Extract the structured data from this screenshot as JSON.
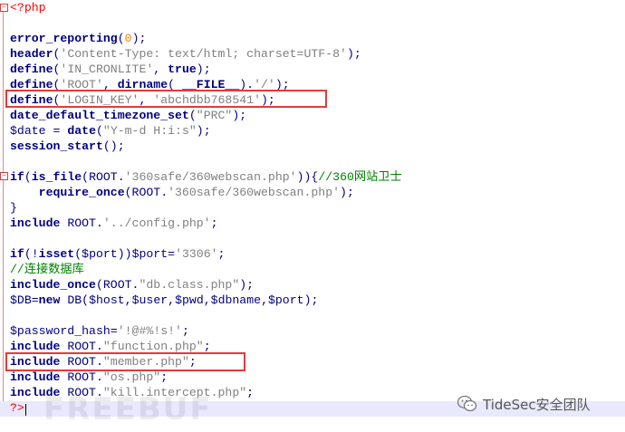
{
  "editor": {
    "lines": [
      {
        "segments": [
          {
            "t": "<?php",
            "c": "php"
          }
        ]
      },
      {
        "segments": []
      },
      {
        "segments": [
          {
            "t": "error_reporting",
            "c": "kw"
          },
          {
            "t": "(",
            "c": "op"
          },
          {
            "t": "0",
            "c": "num"
          },
          {
            "t": ");",
            "c": "op"
          }
        ]
      },
      {
        "segments": [
          {
            "t": "header",
            "c": "kw"
          },
          {
            "t": "(",
            "c": "op"
          },
          {
            "t": "'Content-Type: text/html; charset=UTF-8'",
            "c": "str"
          },
          {
            "t": ");",
            "c": "op"
          }
        ]
      },
      {
        "segments": [
          {
            "t": "define",
            "c": "kw"
          },
          {
            "t": "(",
            "c": "op"
          },
          {
            "t": "'IN_CRONLITE'",
            "c": "str"
          },
          {
            "t": ", ",
            "c": "op"
          },
          {
            "t": "true",
            "c": "kw"
          },
          {
            "t": ");",
            "c": "op"
          }
        ]
      },
      {
        "segments": [
          {
            "t": "define",
            "c": "kw"
          },
          {
            "t": "(",
            "c": "op"
          },
          {
            "t": "'ROOT'",
            "c": "str"
          },
          {
            "t": ", ",
            "c": "op"
          },
          {
            "t": "dirname",
            "c": "kw"
          },
          {
            "t": "( ",
            "c": "op"
          },
          {
            "t": "__FILE__",
            "c": "kw"
          },
          {
            "t": ").",
            "c": "op"
          },
          {
            "t": "'/'",
            "c": "str"
          },
          {
            "t": ");",
            "c": "op"
          }
        ]
      },
      {
        "segments": [
          {
            "t": "define",
            "c": "kw"
          },
          {
            "t": "(",
            "c": "op"
          },
          {
            "t": "'LOGIN_KEY'",
            "c": "str"
          },
          {
            "t": ", ",
            "c": "op"
          },
          {
            "t": "'abchdbb768541'",
            "c": "str"
          },
          {
            "t": ");",
            "c": "op"
          }
        ]
      },
      {
        "segments": [
          {
            "t": "date_default_timezone_set",
            "c": "kw"
          },
          {
            "t": "(",
            "c": "op"
          },
          {
            "t": "\"PRC\"",
            "c": "str"
          },
          {
            "t": ");",
            "c": "op"
          }
        ]
      },
      {
        "segments": [
          {
            "t": "$date",
            "c": "var"
          },
          {
            "t": " = ",
            "c": "op"
          },
          {
            "t": "date",
            "c": "kw"
          },
          {
            "t": "(",
            "c": "op"
          },
          {
            "t": "\"Y-m-d H:i:s\"",
            "c": "str"
          },
          {
            "t": ");",
            "c": "op"
          }
        ]
      },
      {
        "segments": [
          {
            "t": "session_start",
            "c": "kw"
          },
          {
            "t": "();",
            "c": "op"
          }
        ]
      },
      {
        "segments": []
      },
      {
        "segments": [
          {
            "t": "if",
            "c": "kw"
          },
          {
            "t": "(",
            "c": "op"
          },
          {
            "t": "is_file",
            "c": "kw"
          },
          {
            "t": "(ROOT.",
            "c": "op"
          },
          {
            "t": "'360safe/360webscan.php'",
            "c": "str"
          },
          {
            "t": ")){",
            "c": "op"
          },
          {
            "t": "//360网站卫士",
            "c": "cm"
          }
        ]
      },
      {
        "segments": [
          {
            "t": "    require_once",
            "c": "kw"
          },
          {
            "t": "(ROOT.",
            "c": "op"
          },
          {
            "t": "'360safe/360webscan.php'",
            "c": "str"
          },
          {
            "t": ");",
            "c": "op"
          }
        ]
      },
      {
        "segments": [
          {
            "t": "}",
            "c": "op"
          }
        ]
      },
      {
        "segments": [
          {
            "t": "include",
            "c": "kw"
          },
          {
            "t": " ROOT.",
            "c": "op"
          },
          {
            "t": "'../config.php'",
            "c": "str"
          },
          {
            "t": ";",
            "c": "op"
          }
        ]
      },
      {
        "segments": []
      },
      {
        "segments": [
          {
            "t": "if",
            "c": "kw"
          },
          {
            "t": "(!",
            "c": "op"
          },
          {
            "t": "isset",
            "c": "kw"
          },
          {
            "t": "(",
            "c": "op"
          },
          {
            "t": "$port",
            "c": "var"
          },
          {
            "t": "))",
            "c": "op"
          },
          {
            "t": "$port",
            "c": "var"
          },
          {
            "t": "=",
            "c": "op"
          },
          {
            "t": "'3306'",
            "c": "str"
          },
          {
            "t": ";",
            "c": "op"
          }
        ]
      },
      {
        "segments": [
          {
            "t": "//连接数据库",
            "c": "cm"
          }
        ]
      },
      {
        "segments": [
          {
            "t": "include_once",
            "c": "kw"
          },
          {
            "t": "(ROOT.",
            "c": "op"
          },
          {
            "t": "\"db.class.php\"",
            "c": "str"
          },
          {
            "t": ");",
            "c": "op"
          }
        ]
      },
      {
        "segments": [
          {
            "t": "$DB",
            "c": "var"
          },
          {
            "t": "=",
            "c": "op"
          },
          {
            "t": "new",
            "c": "kw"
          },
          {
            "t": " DB(",
            "c": "op"
          },
          {
            "t": "$host",
            "c": "var"
          },
          {
            "t": ",",
            "c": "op"
          },
          {
            "t": "$user",
            "c": "var"
          },
          {
            "t": ",",
            "c": "op"
          },
          {
            "t": "$pwd",
            "c": "var"
          },
          {
            "t": ",",
            "c": "op"
          },
          {
            "t": "$dbname",
            "c": "var"
          },
          {
            "t": ",",
            "c": "op"
          },
          {
            "t": "$port",
            "c": "var"
          },
          {
            "t": ");",
            "c": "op"
          }
        ]
      },
      {
        "segments": []
      },
      {
        "segments": [
          {
            "t": "$password_hash",
            "c": "var"
          },
          {
            "t": "=",
            "c": "op"
          },
          {
            "t": "'!@#%!s!'",
            "c": "str"
          },
          {
            "t": ";",
            "c": "op"
          }
        ]
      },
      {
        "segments": [
          {
            "t": "include",
            "c": "kw"
          },
          {
            "t": " ROOT.",
            "c": "op"
          },
          {
            "t": "\"function.php\"",
            "c": "str"
          },
          {
            "t": ";",
            "c": "op"
          }
        ]
      },
      {
        "segments": [
          {
            "t": "include",
            "c": "kw"
          },
          {
            "t": " ROOT.",
            "c": "op"
          },
          {
            "t": "\"member.php\"",
            "c": "str"
          },
          {
            "t": ";",
            "c": "op"
          }
        ]
      },
      {
        "segments": [
          {
            "t": "include",
            "c": "kw"
          },
          {
            "t": " ROOT.",
            "c": "op"
          },
          {
            "t": "\"os.php\"",
            "c": "str"
          },
          {
            "t": ";",
            "c": "op"
          }
        ]
      },
      {
        "segments": [
          {
            "t": "include",
            "c": "kw"
          },
          {
            "t": " ROOT.",
            "c": "op"
          },
          {
            "t": "\"kill.intercept.php\"",
            "c": "str"
          },
          {
            "t": ";",
            "c": "op"
          }
        ]
      },
      {
        "segments": [
          {
            "t": "?>",
            "c": "php"
          }
        ]
      }
    ]
  },
  "watermark": {
    "brand": "TideSec安全团队",
    "background_text": "FREEBUF"
  },
  "colors": {
    "keyword": "#000080",
    "string": "#808080",
    "number": "#ff8000",
    "comment": "#008000",
    "php_tag": "#ff0000",
    "highlight_box": "#e23b3b"
  }
}
